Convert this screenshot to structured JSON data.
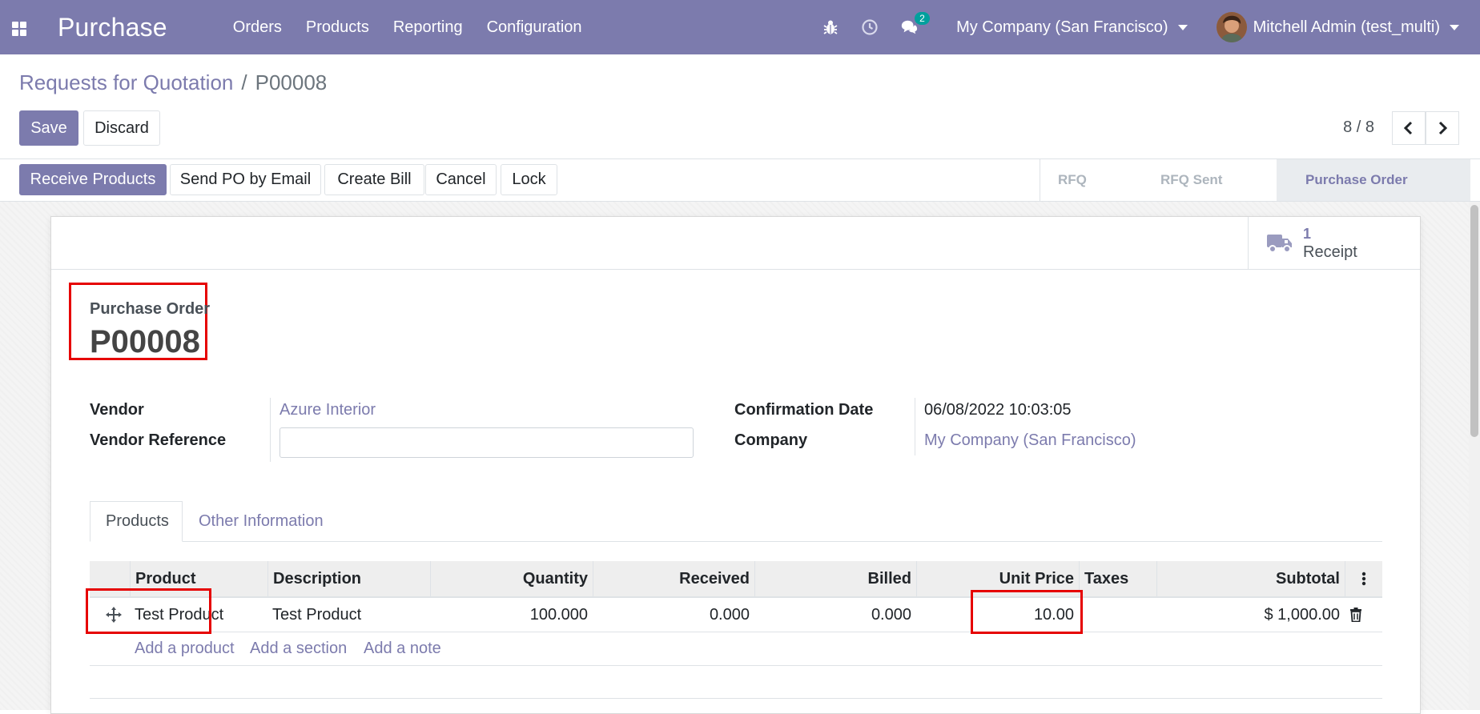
{
  "navbar": {
    "app_name": "Purchase",
    "menu": [
      "Orders",
      "Products",
      "Reporting",
      "Configuration"
    ],
    "messages_badge": "2",
    "company": "My Company (San Francisco)",
    "user": "Mitchell Admin (test_multi)",
    "color": "#7c7bad"
  },
  "breadcrumb": {
    "parent": "Requests for Quotation",
    "separator": "/",
    "current": "P00008"
  },
  "toolbar": {
    "save_label": "Save",
    "discard_label": "Discard"
  },
  "pager": {
    "value": "8 / 8"
  },
  "actions": {
    "receive_products": "Receive Products",
    "send_po_email": "Send PO by Email",
    "create_bill": "Create Bill",
    "cancel": "Cancel",
    "lock": "Lock"
  },
  "status_steps": [
    "RFQ",
    "RFQ Sent",
    "Purchase Order"
  ],
  "smart_button": {
    "count": "1",
    "label": "Receipt"
  },
  "order": {
    "type_label": "Purchase Order",
    "number": "P00008",
    "vendor_label": "Vendor",
    "vendor": "Azure Interior",
    "vendor_ref_label": "Vendor Reference",
    "vendor_ref": "",
    "confirmation_date_label": "Confirmation Date",
    "confirmation_date": "06/08/2022 10:03:05",
    "company_label": "Company",
    "company": "My Company (San Francisco)"
  },
  "tabs": [
    "Products",
    "Other Information"
  ],
  "lines_table": {
    "columns": [
      "Product",
      "Description",
      "Quantity",
      "Received",
      "Billed",
      "Unit Price",
      "Taxes",
      "Subtotal"
    ],
    "rows": [
      {
        "product": "Test Product",
        "description": "Test Product",
        "quantity": "100.000",
        "received": "0.000",
        "billed": "0.000",
        "unit_price": "10.00",
        "taxes": "",
        "subtotal": "$ 1,000.00"
      }
    ],
    "add_product": "Add a product",
    "add_section": "Add a section",
    "add_note": "Add a note"
  }
}
